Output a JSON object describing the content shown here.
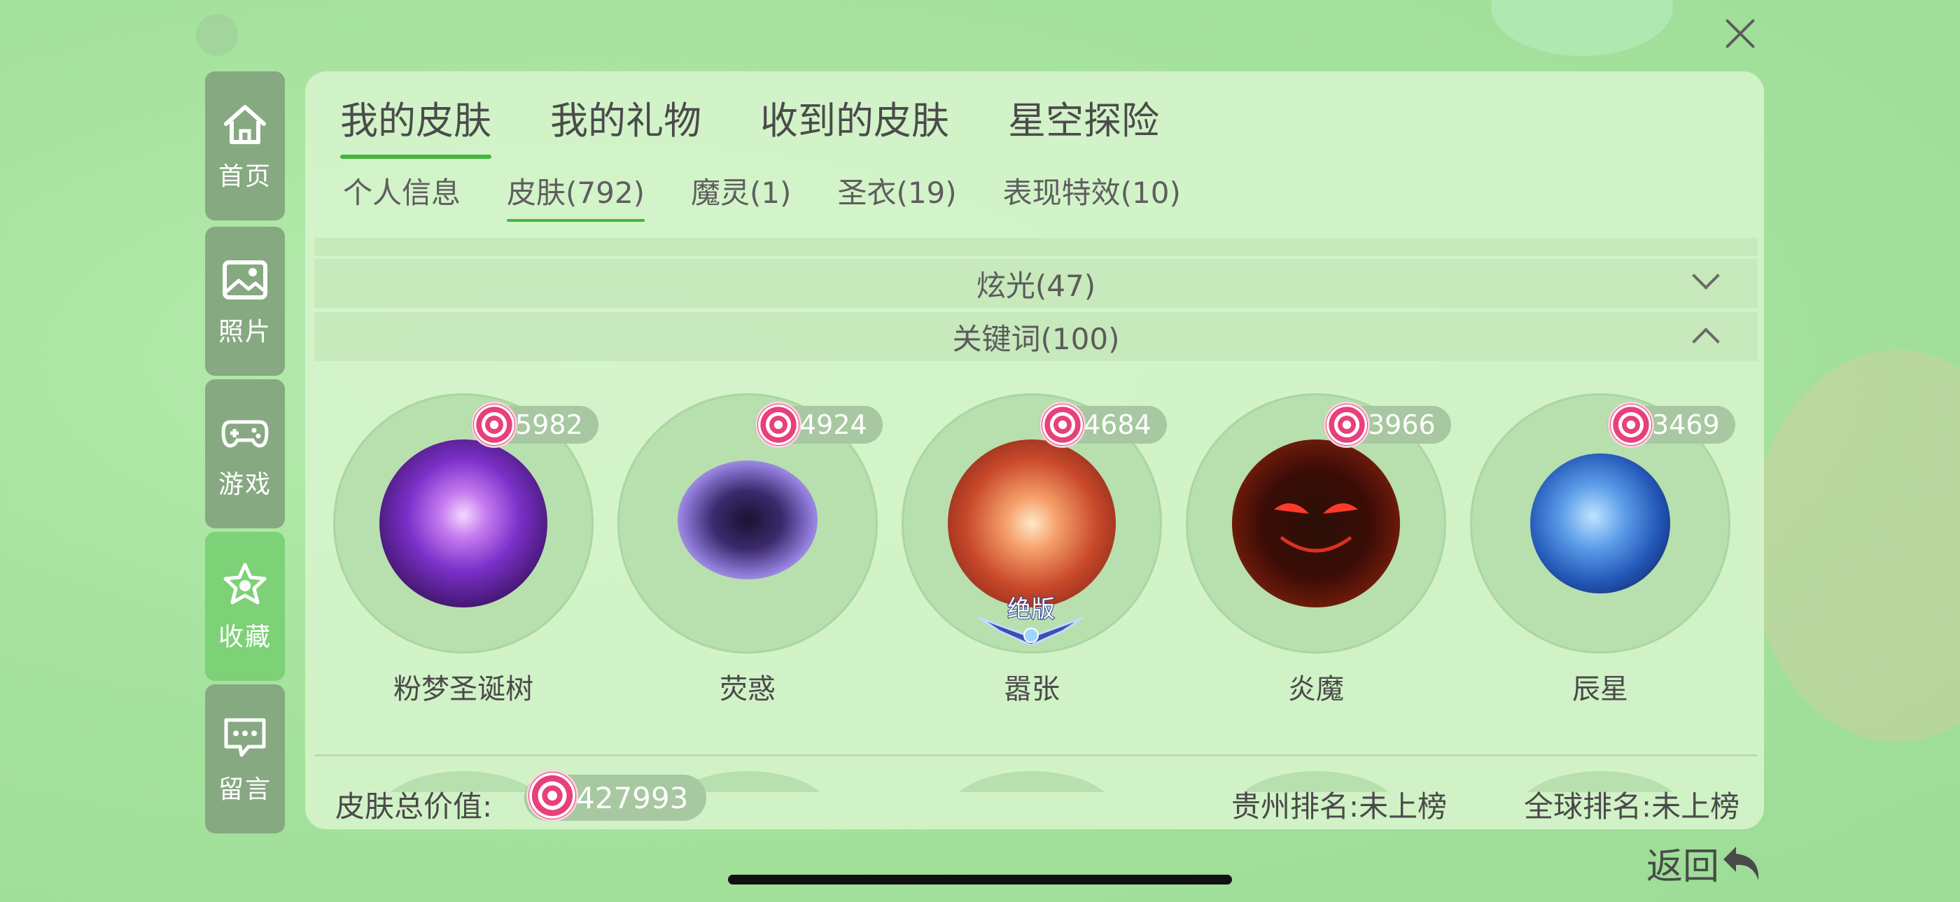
{
  "close_icon": "close-icon",
  "sidebar": {
    "items": [
      {
        "label": "首页",
        "icon": "home-icon",
        "active": false
      },
      {
        "label": "照片",
        "icon": "photo-icon",
        "active": false
      },
      {
        "label": "游戏",
        "icon": "gamepad-icon",
        "active": false
      },
      {
        "label": "收藏",
        "icon": "star-icon",
        "active": true
      },
      {
        "label": "留言",
        "icon": "message-icon",
        "active": false
      }
    ]
  },
  "tabs": [
    "我的皮肤",
    "我的礼物",
    "收到的皮肤",
    "星空探险"
  ],
  "active_tab": 0,
  "subtabs": [
    "个人信息",
    "皮肤(792)",
    "魔灵(1)",
    "圣衣(19)",
    "表现特效(10)"
  ],
  "active_subtab": 1,
  "categories": [
    {
      "label": "炫光(47)",
      "state": "collapsed"
    },
    {
      "label": "关键词(100)",
      "state": "expanded"
    }
  ],
  "skins": [
    {
      "name": "粉梦圣诞树",
      "price": "5982"
    },
    {
      "name": "荧惑",
      "price": "4924"
    },
    {
      "name": "嚣张",
      "price": "4684",
      "badge": "绝版"
    },
    {
      "name": "炎魔",
      "price": "3966"
    },
    {
      "name": "辰星",
      "price": "3469"
    }
  ],
  "footer": {
    "total_label": "皮肤总价值:",
    "total_value": "427993",
    "rank_province": "贵州排名:未上榜",
    "rank_global": "全球排名:未上榜"
  },
  "back_label": "返回",
  "colors": {
    "accent": "#44b43e",
    "sidebar_active": "#7dd177",
    "sidebar": "#86a981",
    "candy": "#e8407a"
  }
}
